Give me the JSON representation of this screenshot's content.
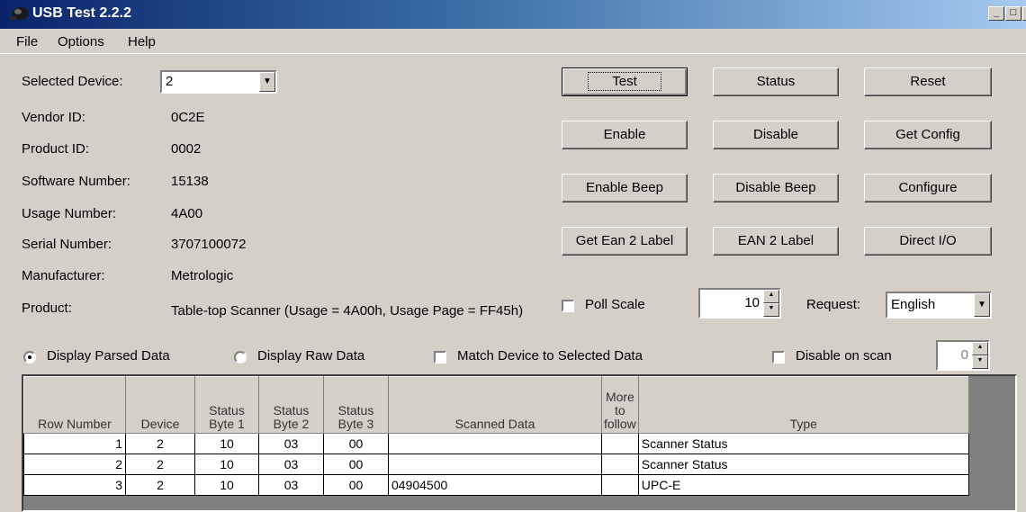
{
  "window": {
    "title": "USB Test 2.2.2",
    "controls": [
      "_",
      "□",
      "x"
    ]
  },
  "menu": [
    "File",
    "Options",
    "Help"
  ],
  "device": {
    "selected_label": "Selected Device:",
    "selected_value": "2",
    "fields": [
      {
        "label": "Vendor ID:",
        "value": "0C2E"
      },
      {
        "label": "Product ID:",
        "value": "0002"
      },
      {
        "label": "Software Number:",
        "value": "15138"
      },
      {
        "label": "Usage Number:",
        "value": "4A00"
      },
      {
        "label": "Serial Number:",
        "value": "3707100072"
      },
      {
        "label": "Manufacturer:",
        "value": "Metrologic"
      },
      {
        "label": "Product:",
        "value": "Table-top Scanner (Usage = 4A00h, Usage Page = FF45h)"
      }
    ]
  },
  "buttons": {
    "test": "Test",
    "status": "Status",
    "reset": "Reset",
    "enable": "Enable",
    "disable": "Disable",
    "get_config": "Get Config",
    "enable_beep": "Enable Beep",
    "disable_beep": "Disable Beep",
    "configure": "Configure",
    "get_ean2": "Get Ean 2 Label",
    "ean2": "EAN 2 Label",
    "direct_io": "Direct I/O"
  },
  "poll": {
    "label": "Poll Scale",
    "checked": false,
    "value": "10",
    "request_label": "Request:",
    "request_value": "English"
  },
  "options": {
    "parsed_label": "Display Parsed Data",
    "parsed_selected": true,
    "raw_label": "Display Raw Data",
    "match_label": "Match Device to Selected Data",
    "match_checked": false,
    "disable_scan_label": "Disable on scan",
    "disable_scan_checked": false,
    "disable_scan_value": "0"
  },
  "table": {
    "headers": [
      "Row Number",
      "Device",
      "Status Byte 1",
      "Status Byte 2",
      "Status Byte 3",
      "Scanned Data",
      "More to follow",
      "Type"
    ],
    "rows": [
      [
        "1",
        "2",
        "10",
        "03",
        "00",
        "",
        "",
        "Scanner Status"
      ],
      [
        "2",
        "2",
        "10",
        "03",
        "00",
        "",
        "",
        "Scanner Status"
      ],
      [
        "3",
        "2",
        "10",
        "03",
        "00",
        "04904500",
        "",
        "UPC-E"
      ]
    ]
  },
  "colors": {
    "face": "#d4d0c8",
    "title_start": "#0a246a",
    "title_end": "#a6caf0"
  }
}
